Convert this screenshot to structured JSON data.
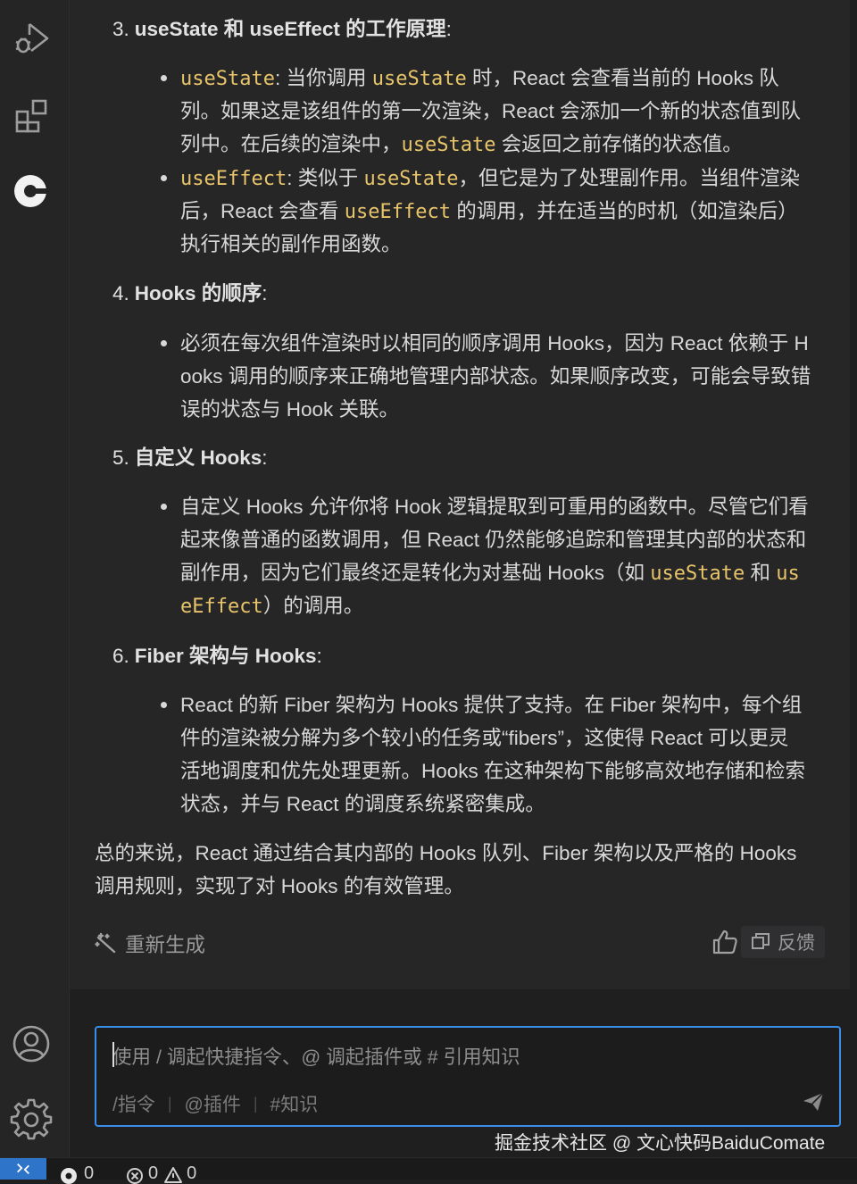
{
  "activity_bar": {
    "icons": [
      "run-debug-icon",
      "extensions-icon",
      "comate-logo-icon",
      "account-icon",
      "settings-gear-icon"
    ]
  },
  "chat": {
    "sections": [
      {
        "num": "3.",
        "title": "useState 和 useEffect 的工作原理",
        "colon": ":",
        "bullets": [
          {
            "l1a": "useState",
            "l1b": ": 当你调用 ",
            "l1c": "useState",
            "l1d": " 时，React 会查看当前的 Hooks 队",
            "l2": "列。如果这是该组件的第一次渲染，React 会添加一个新的状态值到队",
            "l3a": "列中。在后续的渲染中，",
            "l3b": "useState",
            "l3c": " 会返回之前存储的状态值。"
          },
          {
            "l1a": "useEffect",
            "l1b": ": 类似于 ",
            "l1c": "useState",
            "l1d": "，但它是为了处理副作用。当组件渲染",
            "l2a": "后，React 会查看 ",
            "l2b": "useEffect",
            "l2c": " 的调用，并在适当的时机（如渲染后）",
            "l3": "执行相关的副作用函数。"
          }
        ]
      },
      {
        "num": "4.",
        "title": "Hooks 的顺序",
        "colon": ":",
        "bullets": [
          {
            "l1": "必须在每次组件渲染时以相同的顺序调用 Hooks，因为 React 依赖于 H",
            "l2": "ooks 调用的顺序来正确地管理内部状态。如果顺序改变，可能会导致错",
            "l3": "误的状态与 Hook 关联。"
          }
        ]
      },
      {
        "num": "5.",
        "title": "自定义 Hooks",
        "colon": ":",
        "bullets": [
          {
            "l1": "自定义 Hooks 允许你将 Hook 逻辑提取到可重用的函数中。尽管它们看",
            "l2": "起来像普通的函数调用，但 React 仍然能够追踪和管理其内部的状态和",
            "l3a": "副作用，因为它们最终还是转化为对基础 Hooks（如 ",
            "l3b": "useState",
            "l3c": " 和 ",
            "l3d": "us",
            "l4a": "eEffect",
            "l4b": "）的调用。"
          }
        ]
      },
      {
        "num": "6.",
        "title": "Fiber 架构与 Hooks",
        "colon": ":",
        "bullets": [
          {
            "l1": "React 的新 Fiber 架构为 Hooks 提供了支持。在 Fiber 架构中，每个组",
            "l2": "件的渲染被分解为多个较小的任务或“fibers”，这使得 React 可以更灵",
            "l3": "活地调度和优先处理更新。Hooks 在这种架构下能够高效地存储和检索",
            "l4": "状态，并与 React 的调度系统紧密集成。"
          }
        ]
      }
    ],
    "summary_l1": "总的来说，React 通过结合其内部的 Hooks 队列、Fiber 架构以及严格的 Hooks",
    "summary_l2": "调用规则，实现了对 Hooks 的有效管理。",
    "regenerate_label": "重新生成",
    "feedback_label": "反馈"
  },
  "input": {
    "placeholder": "使用 / 调起快捷指令、@ 调起插件或 # 引用知识",
    "quick_command": "/指令",
    "quick_plugin": "@插件",
    "quick_knowledge": "#知识"
  },
  "watermark": "掘金技术社区 @ 文心快码BaiduComate",
  "status_bar": {
    "sync_count": "0",
    "errors": "0",
    "warnings": "0"
  },
  "colors": {
    "accent": "#3b8ee8",
    "code": "#e8c46a",
    "background": "#262627",
    "remote": "#2e74c8"
  }
}
